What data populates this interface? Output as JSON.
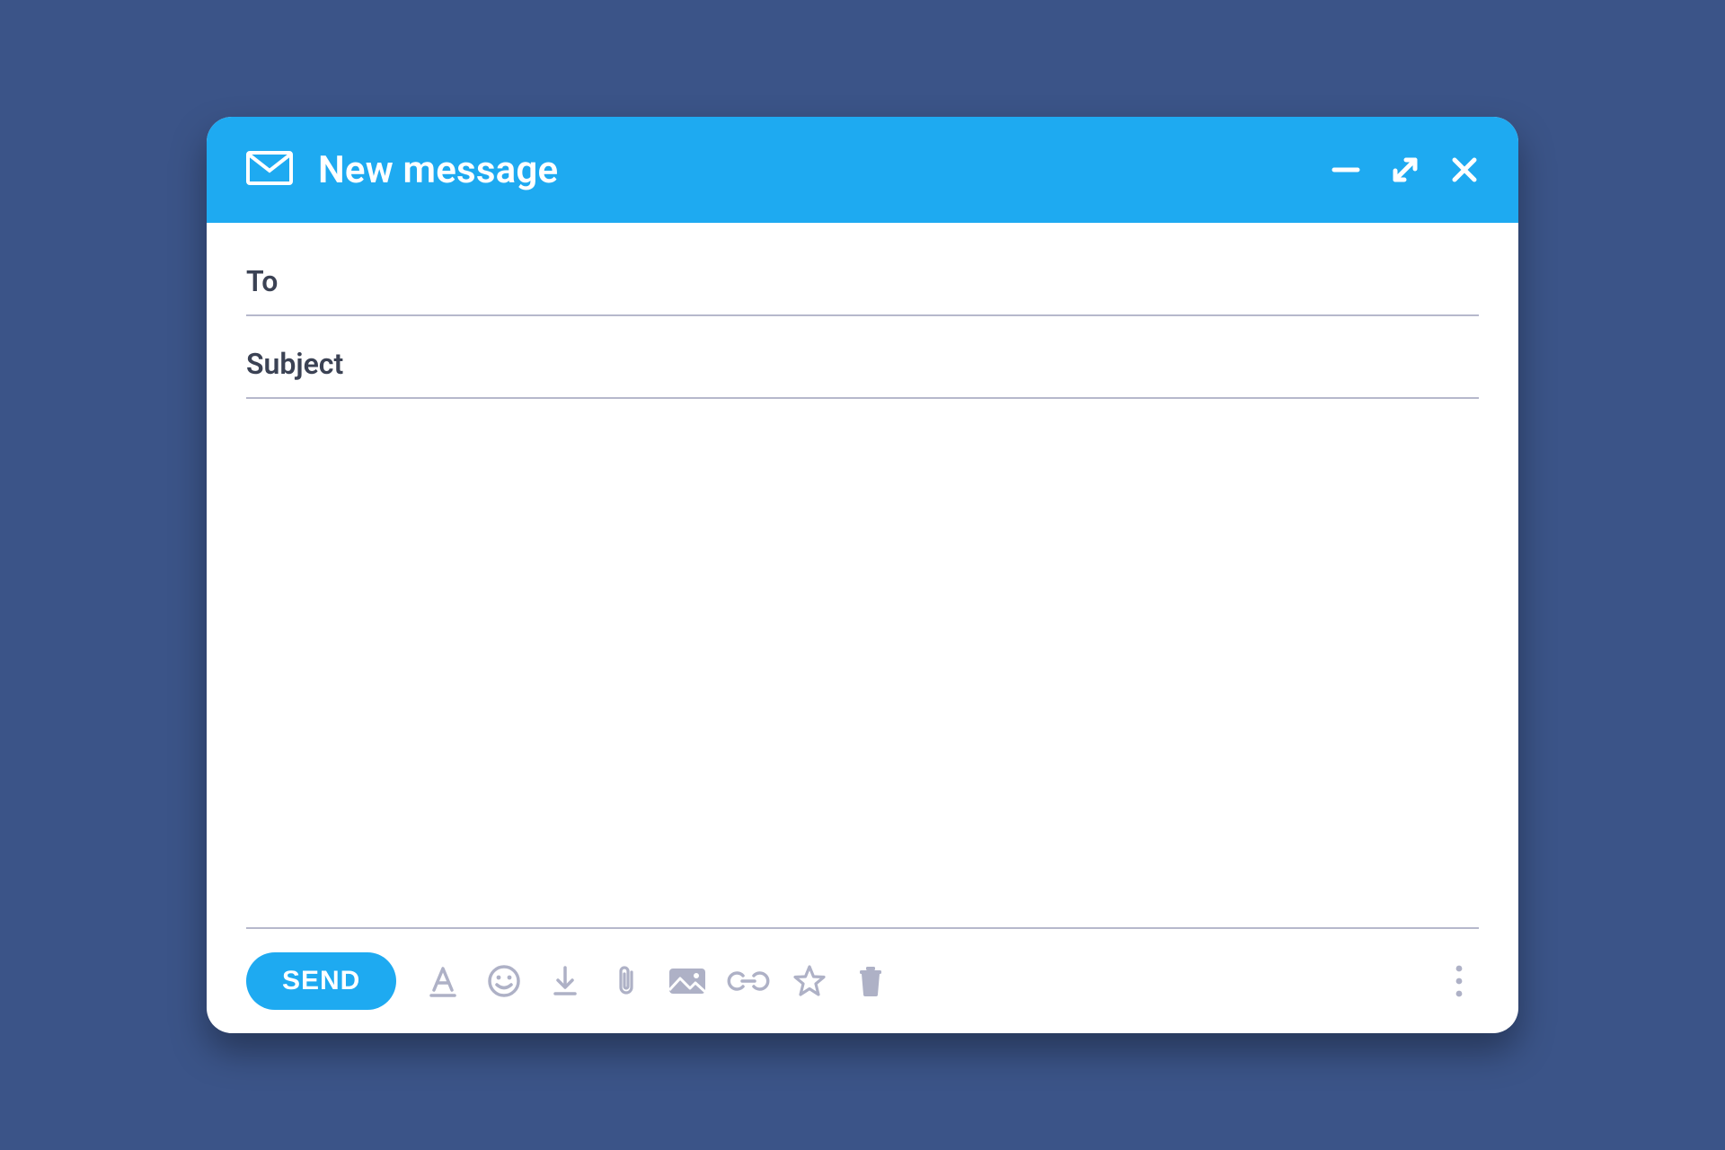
{
  "header": {
    "title": "New message"
  },
  "fields": {
    "to_label": "To",
    "to_value": "",
    "subject_label": "Subject",
    "subject_value": ""
  },
  "body_text": "",
  "toolbar": {
    "send_label": "SEND"
  },
  "icons": {
    "envelope": "envelope-icon",
    "minimize": "minimize-icon",
    "expand": "expand-icon",
    "close": "close-icon",
    "font": "font-icon",
    "emoji": "emoji-icon",
    "download": "download-icon",
    "attach": "paperclip-icon",
    "image": "image-icon",
    "link": "link-icon",
    "star": "star-icon",
    "trash": "trash-icon",
    "more": "more-vertical-icon"
  },
  "colors": {
    "accent": "#1eaaf1",
    "page_bg": "#3b5488",
    "icon_muted": "#aeb1c6",
    "text": "#3b4254",
    "divider": "#b6b8cc"
  }
}
